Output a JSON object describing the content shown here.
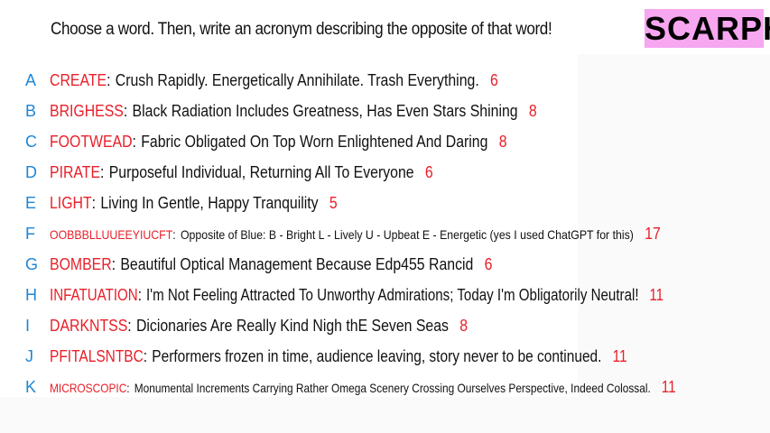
{
  "header": {
    "prompt": "Choose a word. Then, write an acronym describing the opposite of that word!",
    "brand": "SCARPH"
  },
  "entries": [
    {
      "letter": "A",
      "word": "CREATE",
      "acronym": "Crush Rapidly. Energetically Annihilate. Trash Everything.",
      "count": "6"
    },
    {
      "letter": "B",
      "word": "BRIGHESS",
      "acronym": "Black Radiation Includes Greatness, Has Even Stars Shining",
      "count": "8"
    },
    {
      "letter": "C",
      "word": "FOOTWEAD",
      "acronym": "Fabric Obligated On Top Worn Enlightened And Daring",
      "count": "8"
    },
    {
      "letter": "D",
      "word": "PIRATE",
      "acronym": "Purposeful Individual, Returning All To Everyone",
      "count": "6"
    },
    {
      "letter": "E",
      "word": "LIGHT",
      "acronym": "Living In Gentle, Happy Tranquility",
      "count": "5"
    },
    {
      "letter": "F",
      "word": "OOBBBLLUUEEYIUCFT",
      "acronym": "Opposite of Blue:  B - Bright L - Lively U - Upbeat E - Energetic (yes I used ChatGPT for this)",
      "count": "17"
    },
    {
      "letter": "G",
      "word": "BOMBER",
      "acronym": "Beautiful Optical Management Because Edp455 Rancid",
      "count": "6"
    },
    {
      "letter": "H",
      "word": "INFATUATION",
      "acronym": "I'm Not Feeling Attracted To Unworthy Admirations; Today I'm Obligatorily Neutral!",
      "count": "11"
    },
    {
      "letter": "I",
      "word": "DARKNTSS",
      "acronym": "Dicionaries Are Really Kind Nigh thE Seven Seas",
      "count": "8"
    },
    {
      "letter": "J",
      "word": "PFITALSNTBC",
      "acronym": "Performers frozen in time, audience leaving, story never to be continued.",
      "count": "11"
    },
    {
      "letter": "K",
      "word": "MICROSCOPIC",
      "acronym": "Monumental Increments Carrying Rather Omega Scenery Crossing Ourselves Perspective, Indeed Colossal.",
      "count": "11"
    }
  ],
  "colors": {
    "letter": "#1e86d6",
    "word": "#e8202a",
    "count": "#e8202a",
    "brand_bg": "#f7a6f0"
  }
}
